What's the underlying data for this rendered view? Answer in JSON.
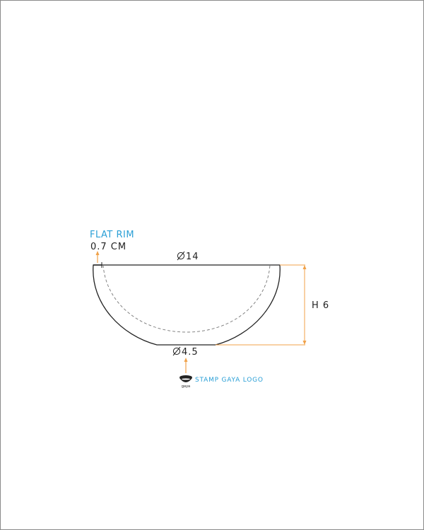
{
  "colors": {
    "accent_blue": "#2a9fd6",
    "dimension_orange": "#f0a24a",
    "outline": "#222222",
    "frame": "#8a8a8a"
  },
  "annotations": {
    "rim_label": "FLAT RIM",
    "rim_thickness": "0.7 CM",
    "top_diameter": "14",
    "base_diameter": "4.5",
    "height": "H 6",
    "stamp_label": "STAMP GAYA LOGO"
  },
  "logo": {
    "wordmark": "gaya",
    "icon": "bowl-logo-icon"
  },
  "symbols": {
    "diameter": "diameter-icon"
  }
}
